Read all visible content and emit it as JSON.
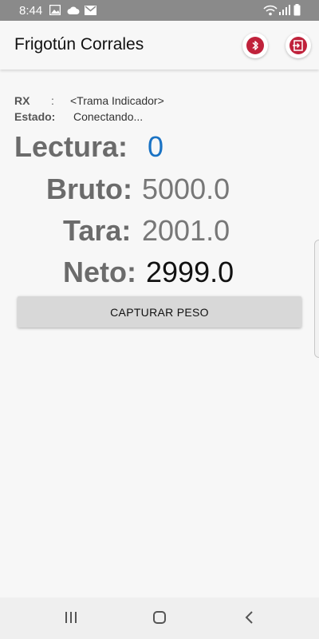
{
  "status_bar": {
    "time": "8:44",
    "icons": [
      "gallery-icon",
      "cloud-icon",
      "mail-icon",
      "wifi-icon",
      "signal-icon",
      "battery-icon"
    ]
  },
  "app_bar": {
    "title": "Frigotún Corrales",
    "actions": [
      "bluetooth-icon",
      "exit-icon"
    ],
    "action_color": "#c0223b"
  },
  "info": {
    "rx_label": "RX",
    "colon": ":",
    "rx_value": "<Trama Indicador>",
    "estado_label": "Estado:",
    "estado_value": "Conectando..."
  },
  "reading": {
    "lectura_label": "Lectura:",
    "lectura_value": "0",
    "lectura_color": "#1a73c4"
  },
  "weights": {
    "bruto_label": "Bruto:",
    "bruto_value": "5000.0",
    "tara_label": "Tara:",
    "tara_value": "2001.0",
    "neto_label": "Neto:",
    "neto_value": "2999.0"
  },
  "actions": {
    "capture_label": "CAPTURAR PESO"
  },
  "nav_bar": {
    "icons": [
      "recents-icon",
      "home-icon",
      "back-icon"
    ]
  }
}
